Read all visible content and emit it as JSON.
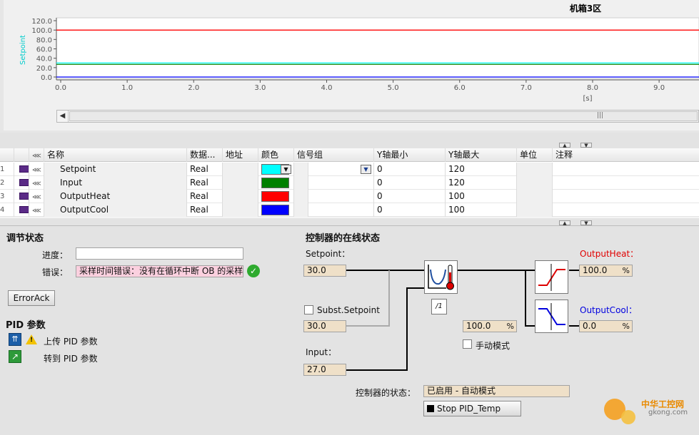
{
  "chart": {
    "title": "机箱3区",
    "ylabel": "Setpoint",
    "xlabel": "[s]",
    "yticks": [
      "120.0",
      "100.0",
      "80.0",
      "60.0",
      "40.0",
      "20.0",
      "0.0"
    ],
    "xticks": [
      "0.0",
      "1.0",
      "2.0",
      "3.0",
      "4.0",
      "5.0",
      "6.0",
      "7.0",
      "8.0",
      "9.0"
    ]
  },
  "chart_data": {
    "type": "line",
    "title": "机箱3区",
    "xlabel": "[s]",
    "ylabel": "Setpoint",
    "xlim": [
      0,
      9.5
    ],
    "ylim": [
      0,
      120
    ],
    "grid": false,
    "x": [
      0,
      9.5
    ],
    "series": [
      {
        "name": "Setpoint",
        "color": "#00ffff",
        "values": [
          30,
          30
        ]
      },
      {
        "name": "Input",
        "color": "#008000",
        "values": [
          27,
          27
        ]
      },
      {
        "name": "OutputHeat",
        "color": "#ff0000",
        "values": [
          100,
          100
        ]
      },
      {
        "name": "OutputCool",
        "color": "#0000ff",
        "values": [
          0,
          0
        ]
      }
    ]
  },
  "table": {
    "headers": {
      "name": "名称",
      "dtype": "数据...",
      "addr": "地址",
      "color": "颜色",
      "group": "信号组",
      "ymin": "Y轴最小",
      "ymax": "Y轴最大",
      "unit": "单位",
      "comment": "注释"
    },
    "rows": [
      {
        "num": "1",
        "name": "Setpoint",
        "dtype": "Real",
        "color": "#00ffff",
        "ymin": "0",
        "ymax": "120"
      },
      {
        "num": "2",
        "name": "Input",
        "dtype": "Real",
        "color": "#008000",
        "ymin": "0",
        "ymax": "120"
      },
      {
        "num": "3",
        "name": "OutputHeat",
        "dtype": "Real",
        "color": "#ff0000",
        "ymin": "0",
        "ymax": "100"
      },
      {
        "num": "4",
        "name": "OutputCool",
        "dtype": "Real",
        "color": "#0000ff",
        "ymin": "0",
        "ymax": "100"
      }
    ]
  },
  "tuning": {
    "title": "调节状态",
    "progress_label": "进度：",
    "progress_value": "",
    "error_label": "错误：",
    "error_text": "采样时间错误：没有在循环中断 OB 的采样时间",
    "error_ack": "ErrorAck"
  },
  "pid_params": {
    "title": "PID 参数",
    "upload_label": "上传 PID 参数",
    "goto_label": "转到 PID 参数"
  },
  "controller": {
    "title": "控制器的在线状态",
    "setpoint_label": "Setpoint：",
    "setpoint_value": "30.0",
    "subst_label": "Subst.Setpoint",
    "subst_value": "30.0",
    "input_label": "Input：",
    "input_value": "27.0",
    "manual_value": "100.0",
    "manual_unit": "%",
    "manual_label": "手动模式",
    "heat_label": "OutputHeat：",
    "heat_value": "100.0",
    "heat_unit": "%",
    "cool_label": "OutputCool：",
    "cool_value": "0.0",
    "cool_unit": "%",
    "state_label": "控制器的状态：",
    "state_value": "已启用 - 自动模式",
    "stop_button": "Stop PID_Temp",
    "tune_glyph": "/1"
  },
  "watermark": {
    "line1": "中华工控网",
    "line2": "gkong.com"
  },
  "colors": {
    "heat": "#e00000",
    "cool": "#0000e0",
    "field": "#efe0c8",
    "error": "#fbd0df"
  }
}
